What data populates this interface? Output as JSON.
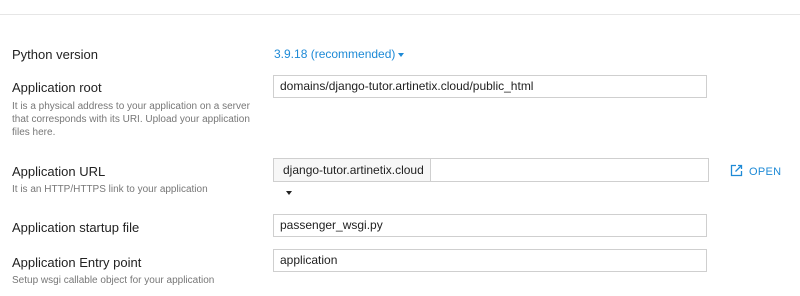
{
  "python": {
    "label": "Python version",
    "value": "3.9.18 (recommended)"
  },
  "app_root": {
    "label": "Application root",
    "hint": "It is a physical address to your application on a server that corresponds with its URI. Upload your application files here.",
    "value": "domains/django-tutor.artinetix.cloud/public_html"
  },
  "app_url": {
    "label": "Application URL",
    "hint": "It is an HTTP/HTTPS link to your application",
    "domain": "django-tutor.artinetix.cloud",
    "path": "",
    "open_label": "OPEN"
  },
  "startup": {
    "label": "Application startup file",
    "value": "passenger_wsgi.py"
  },
  "entry": {
    "label": "Application Entry point",
    "hint": "Setup wsgi callable object for your application",
    "value": "application"
  },
  "colors": {
    "accent": "#1e8ad6",
    "border": "#cfcfcf",
    "hint": "#777777"
  }
}
